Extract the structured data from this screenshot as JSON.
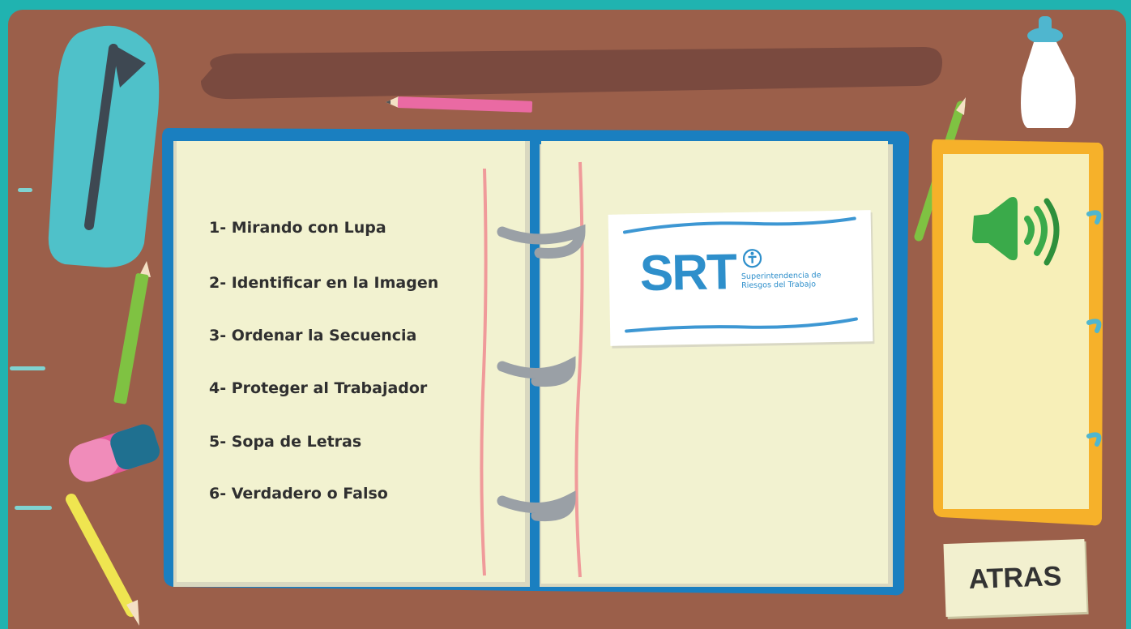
{
  "menu": {
    "items": [
      {
        "label": "1- Mirando con Lupa"
      },
      {
        "label": "2- Identificar en la Imagen"
      },
      {
        "label": "3- Ordenar la Secuencia"
      },
      {
        "label": "4- Proteger al Trabajador"
      },
      {
        "label": "5- Sopa de Letras"
      },
      {
        "label": "6- Verdadero o Falso"
      }
    ]
  },
  "logo": {
    "letters": "SRT",
    "line1": "Superintendencia de",
    "line2": "Riesgos del Trabajo",
    "color": "#2e8fcb"
  },
  "controls": {
    "back_label": "ATRAS",
    "sound_icon": "speaker-icon"
  },
  "colors": {
    "background": "#20b3b0",
    "desk": "#9b5f4a",
    "binder": "#1a7fc0",
    "paper": "#f2f2d0",
    "notepad": "#f6b12a",
    "speaker": "#3aaa4a"
  }
}
